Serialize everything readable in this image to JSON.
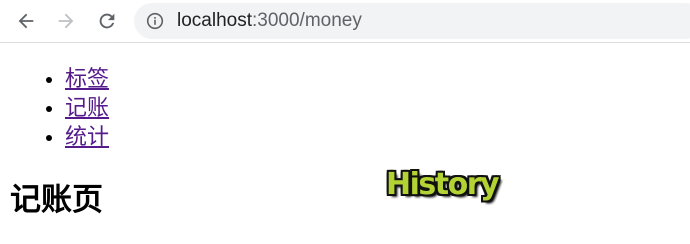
{
  "browser": {
    "url_host": "localhost",
    "url_path": ":3000/money",
    "icons": {
      "back": "arrow-left-icon",
      "forward": "arrow-right-icon",
      "reload": "reload-icon",
      "site_info": "info-circle-icon"
    },
    "forward_enabled": false
  },
  "nav": {
    "items": [
      {
        "label": "标签"
      },
      {
        "label": "记账"
      },
      {
        "label": "统计"
      }
    ]
  },
  "page": {
    "heading": "记账页",
    "overlay_text": "History"
  },
  "colors": {
    "link_visited": "#551a8b",
    "overlay_fill": "#b3d233",
    "overlay_outline": "#111111",
    "omnibox_bg": "#f1f3f4"
  }
}
